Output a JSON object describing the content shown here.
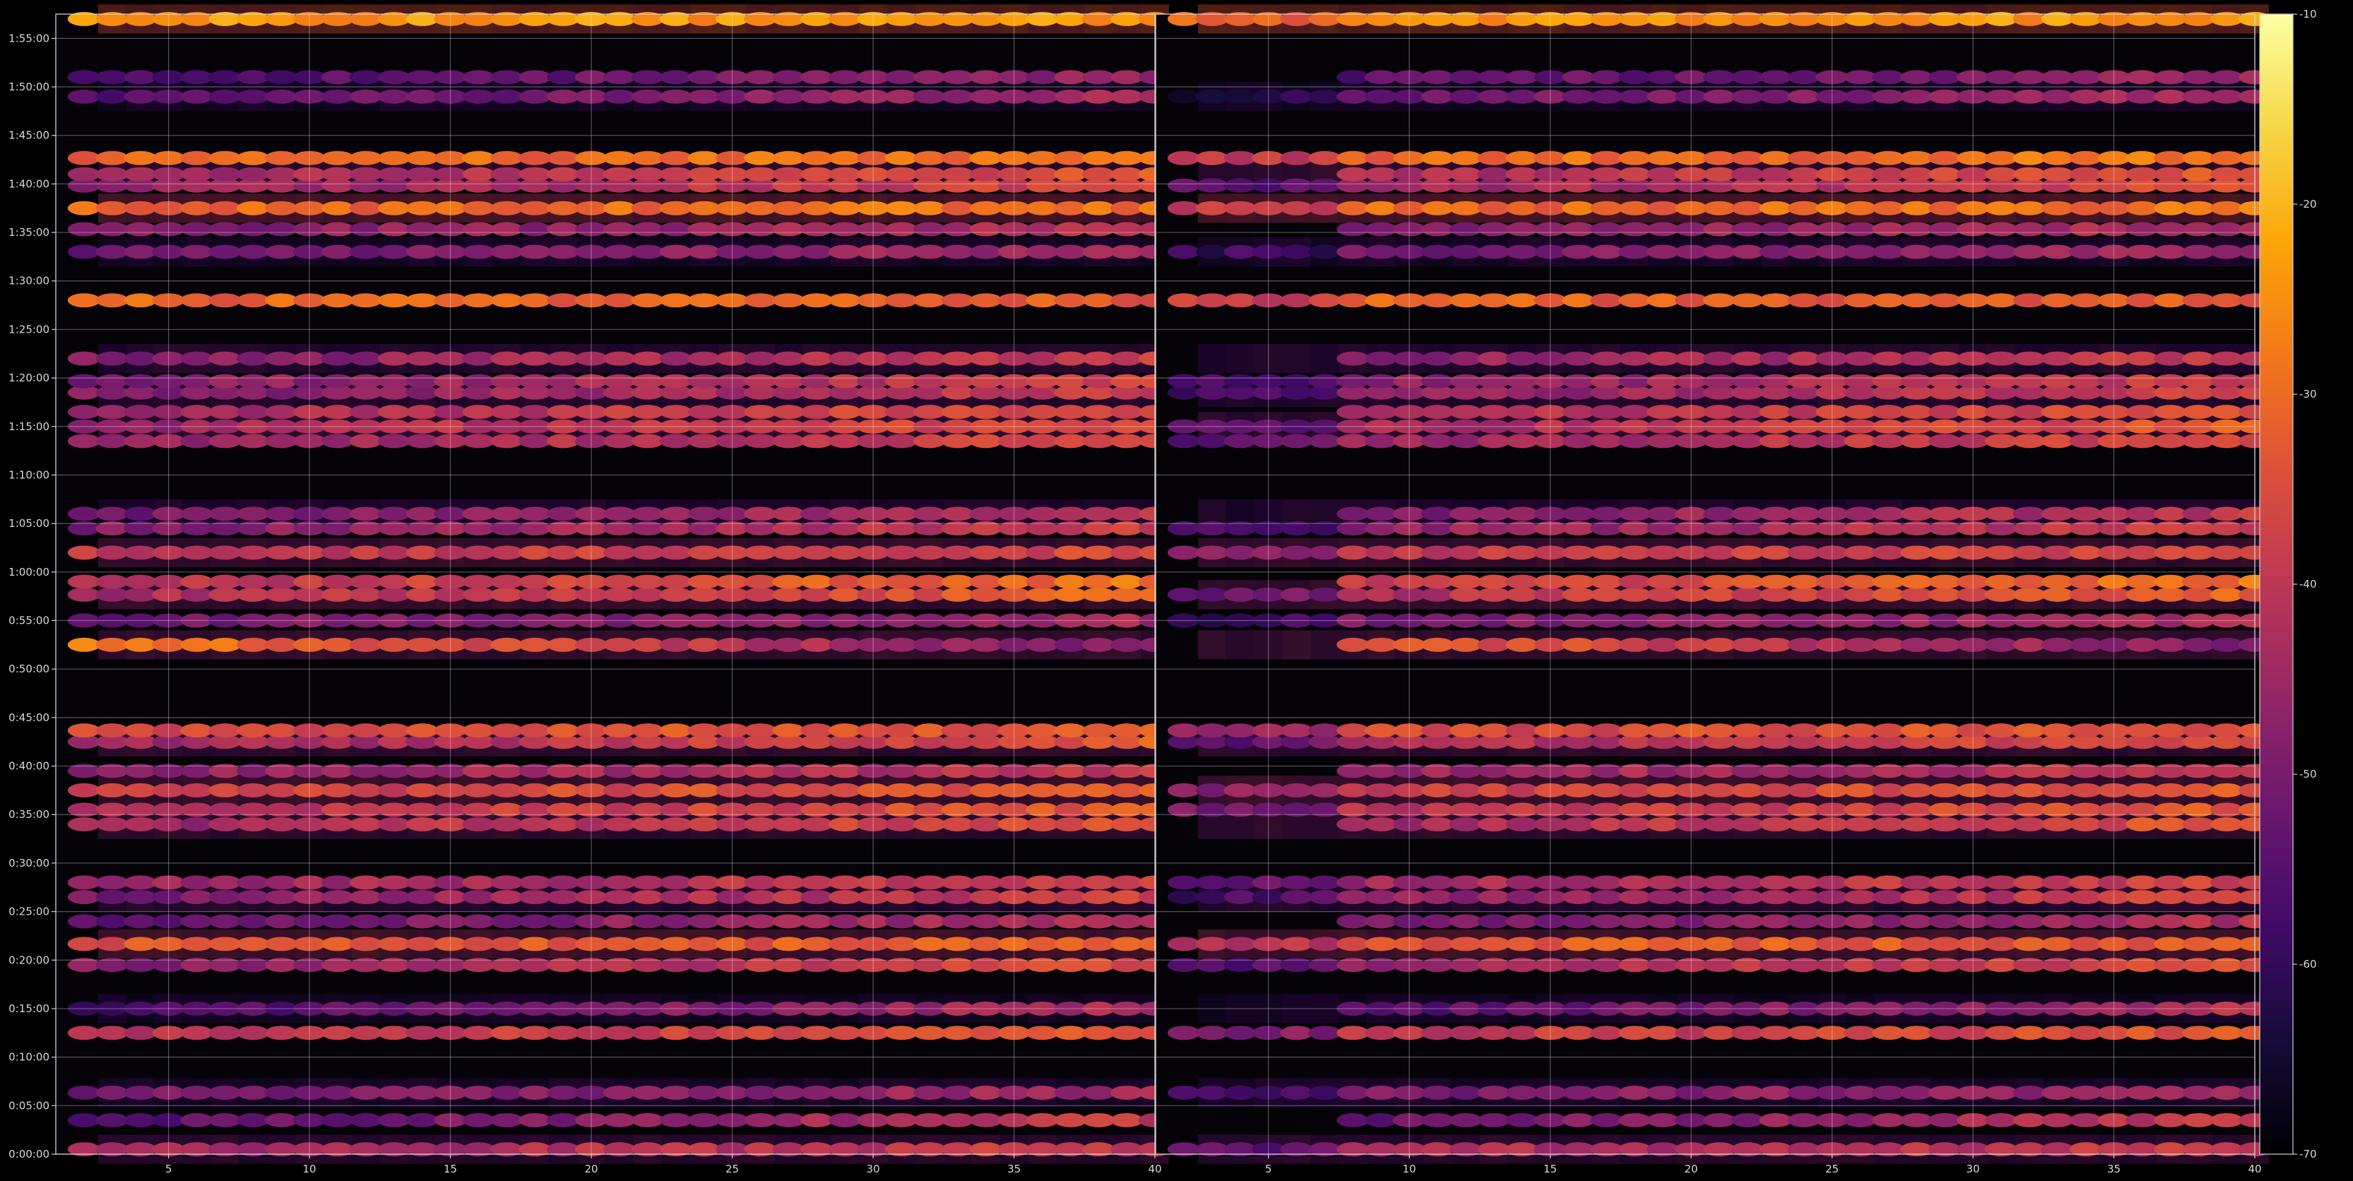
{
  "chart_data": {
    "type": "heatmap",
    "colormap": "inferno",
    "background": "#000000",
    "grid": true,
    "grid_color": "#ffffff",
    "panels": [
      {
        "name": "left",
        "xlim": [
          1,
          40
        ],
        "ylim": [
          "0:00:00",
          "1:57:30"
        ],
        "x_ticks": [
          "5",
          "10",
          "15",
          "20",
          "25",
          "30",
          "35",
          "40"
        ],
        "y_ticks": [
          "0:00:00",
          "0:05:00",
          "0:10:00",
          "0:15:00",
          "0:20:00",
          "0:25:00",
          "0:30:00",
          "0:35:00",
          "0:40:00",
          "0:45:00",
          "0:50:00",
          "0:55:00",
          "1:00:00",
          "1:05:00",
          "1:10:00",
          "1:15:00",
          "1:20:00",
          "1:25:00",
          "1:30:00",
          "1:35:00",
          "1:40:00",
          "1:45:00",
          "1:50:00",
          "1:55:00"
        ]
      },
      {
        "name": "right",
        "xlim": [
          1,
          40
        ],
        "ylim": [
          "0:00:00",
          "1:57:30"
        ],
        "x_ticks": [
          "5",
          "10",
          "15",
          "20",
          "25",
          "30",
          "35",
          "40"
        ]
      }
    ],
    "bands": [
      {
        "t": "0:00:30",
        "level": -42,
        "slope": 0.2
      },
      {
        "t": "0:03:30",
        "level": -48,
        "slope": 0.45
      },
      {
        "t": "0:06:20",
        "level": -48,
        "slope": 0.2
      },
      {
        "t": "0:12:30",
        "level": -38,
        "slope": 0.2
      },
      {
        "t": "0:15:00",
        "level": -50,
        "slope": 0.4
      },
      {
        "t": "0:19:30",
        "level": -42,
        "slope": 0.35
      },
      {
        "t": "0:21:40",
        "level": -33,
        "slope": 0.05
      },
      {
        "t": "0:24:00",
        "level": -48,
        "slope": 0.3
      },
      {
        "t": "0:26:30",
        "level": -44,
        "slope": 0.35
      },
      {
        "t": "0:28:00",
        "level": -42,
        "slope": 0.25
      },
      {
        "t": "0:34:00",
        "level": -40,
        "slope": 0.3
      },
      {
        "t": "0:35:30",
        "level": -38,
        "slope": 0.25
      },
      {
        "t": "0:37:30",
        "level": -36,
        "slope": 0.2
      },
      {
        "t": "0:39:30",
        "level": -44,
        "slope": 0.2
      },
      {
        "t": "0:42:30",
        "level": -40,
        "slope": 0.35
      },
      {
        "t": "0:43:40",
        "level": -35,
        "slope": 0.1
      },
      {
        "t": "0:52:30",
        "level": -38,
        "slope": -0.55
      },
      {
        "t": "0:55:00",
        "level": -48,
        "slope": 0.2
      },
      {
        "t": "0:57:40",
        "level": -38,
        "slope": 0.35
      },
      {
        "t": "0:59:00",
        "level": -36,
        "slope": 0.35
      },
      {
        "t": "1:02:00",
        "level": -38,
        "slope": 0.1
      },
      {
        "t": "1:04:30",
        "level": -44,
        "slope": 0.3
      },
      {
        "t": "1:06:00",
        "level": -46,
        "slope": 0.3
      },
      {
        "t": "1:13:30",
        "level": -42,
        "slope": 0.3
      },
      {
        "t": "1:15:00",
        "level": -40,
        "slope": 0.35
      },
      {
        "t": "1:16:30",
        "level": -40,
        "slope": 0.3
      },
      {
        "t": "1:18:30",
        "level": -44,
        "slope": 0.3
      },
      {
        "t": "1:19:40",
        "level": -44,
        "slope": 0.3
      },
      {
        "t": "1:22:00",
        "level": -44,
        "slope": 0.3
      },
      {
        "t": "1:28:00",
        "level": -32,
        "slope": -0.05
      },
      {
        "t": "1:33:00",
        "level": -48,
        "slope": 0.2
      },
      {
        "t": "1:35:20",
        "level": -46,
        "slope": 0.2
      },
      {
        "t": "1:37:30",
        "level": -30,
        "slope": 0.05
      },
      {
        "t": "1:39:50",
        "level": -42,
        "slope": 0.3
      },
      {
        "t": "1:41:00",
        "level": -40,
        "slope": 0.3
      },
      {
        "t": "1:42:40",
        "level": -30,
        "slope": 0.05
      },
      {
        "t": "1:49:00",
        "level": -50,
        "slope": 0.3
      },
      {
        "t": "1:51:00",
        "level": -52,
        "slope": 0.3
      },
      {
        "t": "1:57:00",
        "level": -24,
        "slope": 0.0
      }
    ],
    "colorbar": {
      "range": [
        -70,
        -10
      ],
      "ticks": [
        "-10",
        "-20",
        "-30",
        "-40",
        "-50",
        "-60",
        "-70"
      ]
    }
  }
}
